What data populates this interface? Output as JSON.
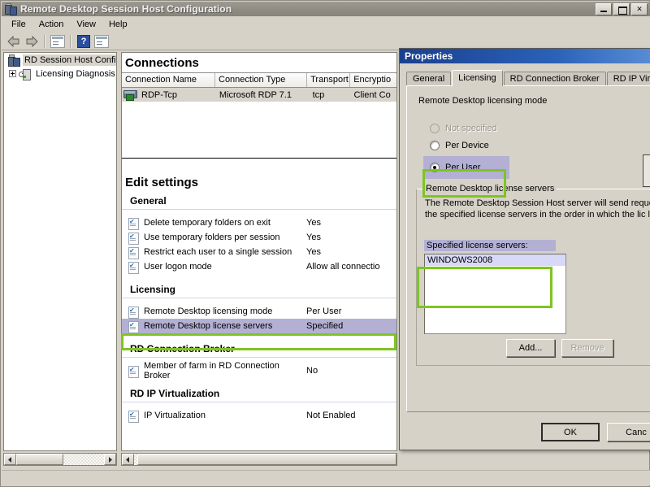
{
  "window": {
    "title": "Remote Desktop Session Host Configuration",
    "icon": "mmc-console-icon",
    "buttons": {
      "minimize": "minimize-icon",
      "restore": "restore-icon",
      "close": "close-icon"
    }
  },
  "menubar": {
    "items": [
      "File",
      "Action",
      "View",
      "Help"
    ]
  },
  "toolbar": {
    "items": [
      "back-arrow-icon",
      "forward-arrow-icon",
      "show-tree-icon",
      "help-icon",
      "show-action-pane-icon"
    ]
  },
  "tree": {
    "items": [
      {
        "label": "RD Session Host Configu",
        "icon": "mmc-console-icon",
        "selected": true,
        "expander": false
      },
      {
        "label": "Licensing Diagnosis",
        "icon": "licensing-server-icon",
        "selected": false,
        "expander": true
      }
    ]
  },
  "connections": {
    "heading": "Connections",
    "columns": [
      "Connection Name",
      "Connection Type",
      "Transport",
      "Encryptio"
    ],
    "rows": [
      {
        "name": "RDP-Tcp",
        "type": "Microsoft RDP 7.1",
        "transport": "tcp",
        "encryption": "Client Co",
        "icon": "rdp-connection-icon"
      }
    ]
  },
  "edit_settings": {
    "heading": "Edit settings",
    "groups": [
      {
        "name": "General",
        "rows": [
          {
            "label": "Delete temporary folders on exit",
            "value": "Yes",
            "highlighted": false
          },
          {
            "label": "Use temporary folders per session",
            "value": "Yes",
            "highlighted": false
          },
          {
            "label": "Restrict each user to a single session",
            "value": "Yes",
            "highlighted": false
          },
          {
            "label": "User logon mode",
            "value": "Allow all connectio",
            "highlighted": false
          }
        ]
      },
      {
        "name": "Licensing",
        "rows": [
          {
            "label": "Remote Desktop licensing mode",
            "value": "Per User",
            "highlighted": false
          },
          {
            "label": "Remote Desktop license servers",
            "value": "Specified",
            "highlighted": true
          }
        ]
      },
      {
        "name": "RD Connection Broker",
        "rows": [
          {
            "label": "Member of farm in RD Connection Broker",
            "value": "No",
            "highlighted": false
          }
        ]
      },
      {
        "name": "RD IP Virtualization",
        "rows": [
          {
            "label": "IP Virtualization",
            "value": "Not Enabled",
            "highlighted": false
          }
        ]
      }
    ]
  },
  "dialog": {
    "title": "Properties",
    "tabs": [
      {
        "label": "General",
        "active": false
      },
      {
        "label": "Licensing",
        "active": true
      },
      {
        "label": "RD Connection Broker",
        "active": false
      },
      {
        "label": "RD IP Virtualiz",
        "active": false
      }
    ],
    "licensing": {
      "mode_label": "Remote Desktop licensing mode",
      "options": [
        {
          "label": "Not specified",
          "checked": false,
          "disabled": true,
          "highlighted": false
        },
        {
          "label": "Per Device",
          "checked": false,
          "disabled": false,
          "highlighted": false
        },
        {
          "label": "Per User",
          "checked": true,
          "disabled": false,
          "highlighted": true
        }
      ],
      "group_legend": "Remote Desktop license servers",
      "group_description": "The Remote Desktop Session Host server will send reques to the specified license servers in the order in which the lic listed.",
      "servers_label": "Specified license servers:",
      "servers": [
        "WINDOWS2008"
      ],
      "add_button": "Add...",
      "remove_button": "Remove"
    },
    "footer": {
      "ok": "OK",
      "cancel": "Canc"
    }
  },
  "colors": {
    "highlight_border": "#7ec520",
    "highlight_fill": "#b3b0d4",
    "titlebar_active": "#2a62b8",
    "window_bg": "#d6d2c8"
  }
}
